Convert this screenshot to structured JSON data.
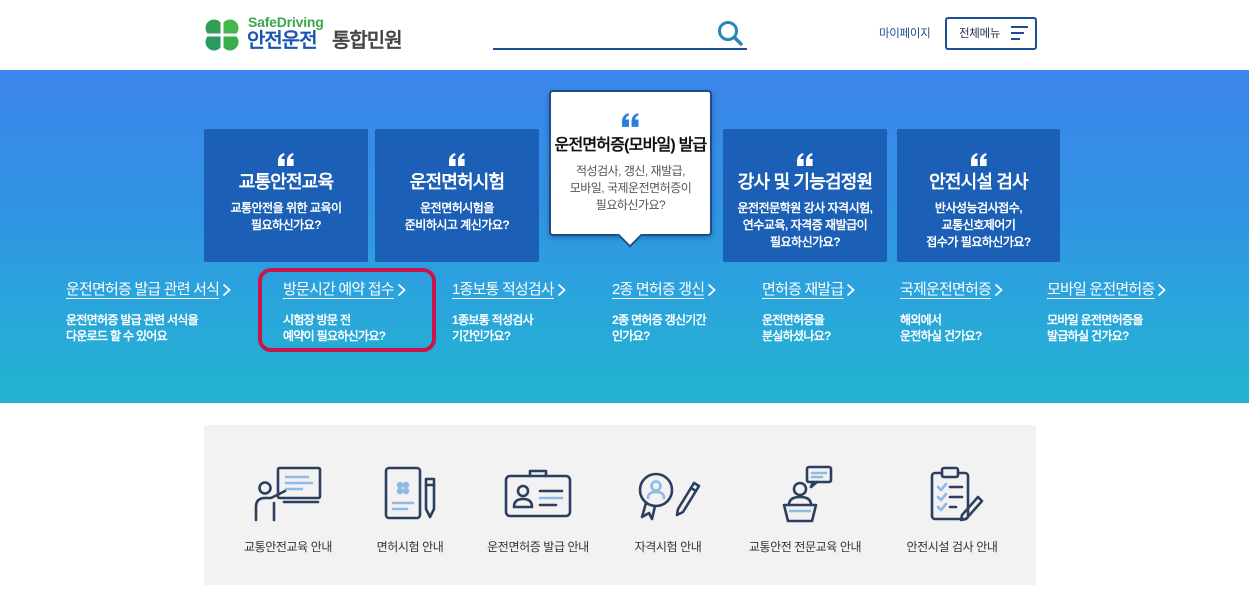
{
  "header": {
    "logo_en": "SafeDriving",
    "logo_ko": "안전운전",
    "logo_service": "통합민원",
    "mypage": "마이페이지",
    "all_menu": "전체메뉴"
  },
  "icons": {
    "logo": "clover-logo-icon",
    "search": "search-icon",
    "menu": "hamburger-menu-icon",
    "card_quote": "quote-icon",
    "link_arrow": "chevron-right-icon"
  },
  "hero": {
    "cards": [
      {
        "title": "교통안전교육",
        "desc": [
          "교통안전을 위한 교육이",
          "필요하신가요?"
        ]
      },
      {
        "title": "운전면허시험",
        "desc": [
          "운전면허시험을",
          "준비하시고 계신가요?"
        ]
      },
      {
        "title": "운전면허증(모바일) 발급",
        "desc": [
          "적성검사, 갱신, 재발급,",
          "모바일, 국제운전면허증이",
          "필요하신가요?"
        ],
        "active": true
      },
      {
        "title": "강사 및 기능검정원",
        "desc": [
          "운전전문학원 강사 자격시험,",
          "연수교육, 자격증 재발급이",
          "필요하신가요?"
        ]
      },
      {
        "title": "안전시설 검사",
        "desc": [
          "반사성능검사접수,",
          "교통신호제어기",
          "접수가 필요하신가요?"
        ]
      }
    ],
    "links": [
      {
        "title": "운전면허증 발급 관련 서식",
        "desc": [
          "운전면허증 발급 관련 서식을",
          "다운로드 할 수 있어요"
        ]
      },
      {
        "title": "방문시간 예약 접수",
        "desc": [
          "시험장 방문 전",
          "예약이 필요하신가요?"
        ],
        "highlighted": true
      },
      {
        "title": "1종보통 적성검사",
        "desc": [
          "1종보통 적성검사",
          "기간인가요?"
        ]
      },
      {
        "title": "2종 면허증 갱신",
        "desc": [
          "2종 면허증 갱신기간",
          "인가요?"
        ]
      },
      {
        "title": "면허증 재발급",
        "desc": [
          "운전면허증을",
          "분실하셨나요?"
        ]
      },
      {
        "title": "국제운전면허증",
        "desc": [
          "해외에서",
          "운전하실 건가요?"
        ]
      },
      {
        "title": "모바일 운전면허증",
        "desc": [
          "모바일 운전면허증을",
          "발급하실 건가요?"
        ]
      }
    ]
  },
  "services": [
    {
      "label": "교통안전교육 안내",
      "icon": "instructor-board-icon"
    },
    {
      "label": "면허시험 안내",
      "icon": "exam-document-pen-icon"
    },
    {
      "label": "운전면허증 발급 안내",
      "icon": "license-card-icon"
    },
    {
      "label": "자격시험 안내",
      "icon": "certificate-pen-icon"
    },
    {
      "label": "교통안전 전문교육 안내",
      "icon": "speaker-podium-icon"
    },
    {
      "label": "안전시설 검사 안내",
      "icon": "checklist-clipboard-icon"
    }
  ],
  "colors": {
    "brand_green": "#3aa64b",
    "brand_blue": "#1a55b0",
    "navy": "#1b4f91",
    "hero_top": "#3c85ea",
    "hero_bottom": "#22b4cf",
    "card_bg": "#1b5fb6",
    "active_card_bg": "#ffffff",
    "highlight_border": "#c8164c",
    "service_panel_bg": "#f2f2f2"
  }
}
